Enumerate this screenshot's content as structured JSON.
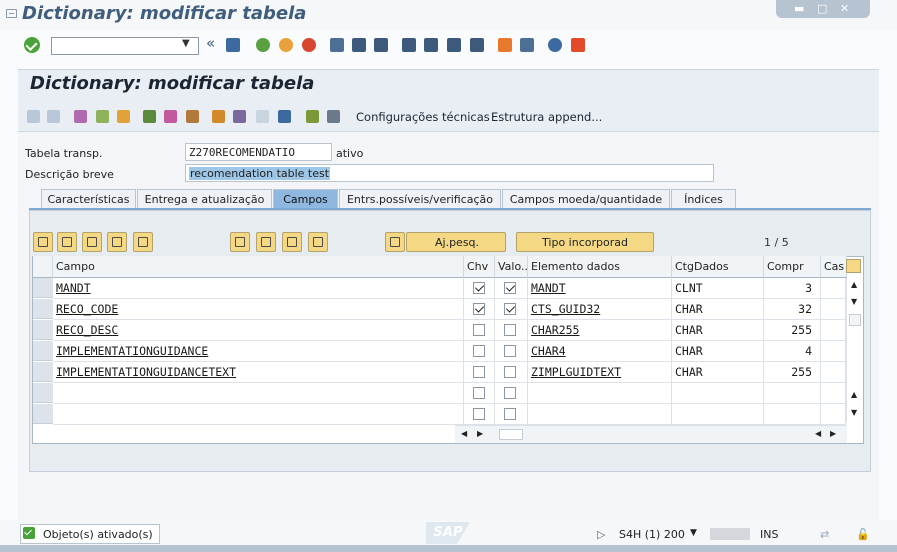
{
  "window": {
    "title": "Dictionary: modificar tabela",
    "controls": [
      "minimize",
      "maximize",
      "close"
    ]
  },
  "system_toolbar": {
    "command_field": "",
    "icons": [
      "ok-icon",
      "back-icon",
      "save-icon",
      "back-nav-icon",
      "exit-icon",
      "cancel-icon",
      "print-icon",
      "find-icon",
      "find-next-icon",
      "first-page-icon",
      "prev-page-icon",
      "next-page-icon",
      "last-page-icon",
      "new-session-icon",
      "shortcut-icon",
      "help-icon",
      "layout-icon"
    ]
  },
  "header": {
    "title": "Dictionary: modificar tabela"
  },
  "app_toolbar": {
    "config_label": "Configurações técnicas",
    "append_label": "Estrutura append..."
  },
  "form": {
    "table_type_label": "Tabela transp.",
    "table_name": "Z270RECOMENDATIO",
    "status": "ativo",
    "desc_label": "Descrição breve",
    "description": "recomendation table test"
  },
  "tabs": [
    {
      "label": "Características",
      "active": false
    },
    {
      "label": "Entrega e atualização",
      "active": false
    },
    {
      "label": "Campos",
      "active": true
    },
    {
      "label": "Entrs.possíveis/verificação",
      "active": false
    },
    {
      "label": "Campos moeda/quantidade",
      "active": false
    },
    {
      "label": "Índices",
      "active": false
    }
  ],
  "table_toolbar": {
    "ajpesq_label": "Aj.pesq.",
    "tipo_label": "Tipo incorporad",
    "page_indicator": "1 / 5"
  },
  "table": {
    "columns": [
      "Campo",
      "Chv",
      "Valo...",
      "Elemento dados",
      "CtgDados",
      "Compr",
      "Cas"
    ],
    "rows": [
      {
        "campo": "MANDT",
        "chv": true,
        "valo": true,
        "elemento": "MANDT",
        "ctg": "CLNT",
        "compr": "3"
      },
      {
        "campo": "RECO_CODE",
        "chv": true,
        "valo": true,
        "elemento": "CTS_GUID32",
        "ctg": "CHAR",
        "compr": "32"
      },
      {
        "campo": "RECO_DESC",
        "chv": false,
        "valo": false,
        "elemento": "CHAR255",
        "ctg": "CHAR",
        "compr": "255"
      },
      {
        "campo": "IMPLEMENTATIONGUIDANCE",
        "chv": false,
        "valo": false,
        "elemento": "CHAR4",
        "ctg": "CHAR",
        "compr": "4"
      },
      {
        "campo": "IMPLEMENTATIONGUIDANCETEXT",
        "chv": false,
        "valo": false,
        "elemento": "ZIMPLGUIDTEXT",
        "ctg": "CHAR",
        "compr": "255"
      },
      {
        "campo": "",
        "chv": false,
        "valo": false,
        "elemento": "",
        "ctg": "",
        "compr": ""
      },
      {
        "campo": "",
        "chv": false,
        "valo": false,
        "elemento": "",
        "ctg": "",
        "compr": ""
      }
    ]
  },
  "status_bar": {
    "message": "Objeto(s) ativado(s)",
    "logo": "SAP",
    "system": "S4H (1) 200",
    "mode": "INS"
  },
  "colors": {
    "accent": "#8fb8e0",
    "button": "#f4d884",
    "title": "#3f5d7d",
    "ok": "#4aa23a"
  }
}
